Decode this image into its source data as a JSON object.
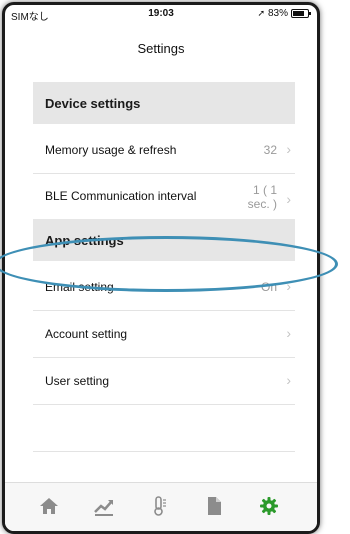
{
  "status_bar": {
    "carrier": "SIMなし",
    "time": "19:03",
    "battery": "83%"
  },
  "nav": {
    "title": "Settings"
  },
  "sections": {
    "device": {
      "title": "Device settings"
    },
    "app": {
      "title": "App settings"
    }
  },
  "rows": {
    "memory": {
      "label": "Memory usage & refresh",
      "value": "32"
    },
    "ble": {
      "label": "BLE Communication interval",
      "value_line1": "1 ( 1",
      "value_line2": "sec. )"
    },
    "email": {
      "label": "Email setting",
      "value": "On"
    },
    "account": {
      "label": "Account setting"
    },
    "user": {
      "label": "User setting"
    }
  },
  "chevron": "›",
  "tabs": [
    {
      "icon": "home-icon"
    },
    {
      "icon": "chart-icon"
    },
    {
      "icon": "thermometer-icon"
    },
    {
      "icon": "document-icon"
    },
    {
      "icon": "gear-icon",
      "active": true
    }
  ],
  "colors": {
    "active_tab": "#2b9a2b",
    "inactive_tab": "#8c8c8c",
    "highlight_ellipse": "#3e8fb5"
  }
}
